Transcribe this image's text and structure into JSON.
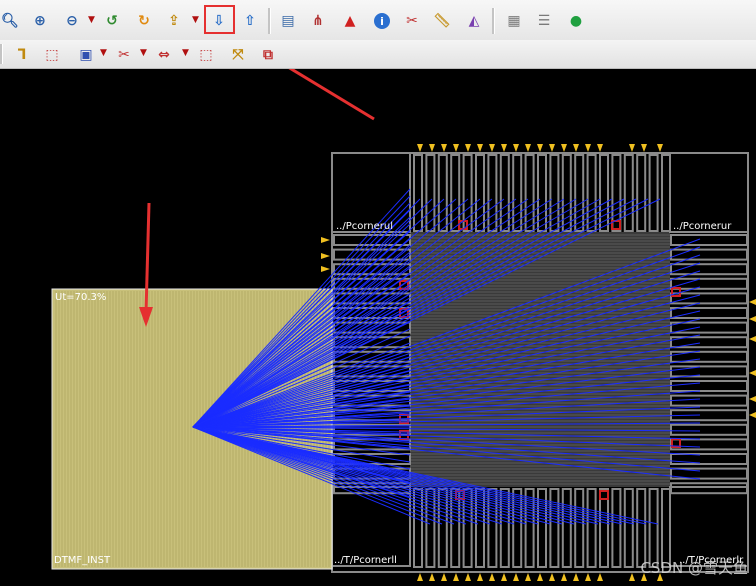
{
  "toolbar_row1": [
    {
      "icon": "zoom-icon",
      "glyph": "🔍︎",
      "color": "#2a5fa8"
    },
    {
      "icon": "zoom-in-icon",
      "glyph": "⊕",
      "color": "#2a5fa8"
    },
    {
      "icon": "zoom-out-icon",
      "glyph": "⊖",
      "color": "#2a5fa8"
    },
    {
      "icon": "pan-icon",
      "glyph": "↺",
      "color": "#2f8a2f"
    },
    {
      "icon": "refresh-icon",
      "glyph": "↻",
      "color": "#e08a10"
    },
    {
      "icon": "load-icon",
      "glyph": "⇪",
      "color": "#c08a10"
    },
    {
      "icon": "push-down-icon",
      "glyph": "⇩",
      "color": "#2a6fc8"
    },
    {
      "icon": "pop-up-icon",
      "glyph": "⇧",
      "color": "#2a6fc8"
    },
    {
      "icon": "panel-icon",
      "glyph": "▤",
      "color": "#3a6aa8"
    },
    {
      "icon": "hierarchy-icon",
      "glyph": "⋔",
      "color": "#b03030"
    },
    {
      "icon": "warning-icon",
      "glyph": "▲",
      "color": "#d02020"
    },
    {
      "icon": "info-icon",
      "glyph": "i",
      "color": "#ffffff"
    },
    {
      "icon": "cut-icon",
      "glyph": "✂",
      "color": "#c03030"
    },
    {
      "icon": "ruler-icon",
      "glyph": "📏︎",
      "color": "#c89a30"
    },
    {
      "icon": "measure-icon",
      "glyph": "◭",
      "color": "#7a40b0"
    },
    {
      "icon": "properties-icon",
      "glyph": "▦",
      "color": "#7a7a7a"
    },
    {
      "icon": "document-icon",
      "glyph": "☰",
      "color": "#7a7a7a"
    },
    {
      "icon": "go-icon",
      "glyph": "●",
      "color": "#20a040"
    }
  ],
  "toolbar_row2": [
    {
      "icon": "route-icon",
      "glyph": "ᒣ",
      "color": "#c08a10"
    },
    {
      "icon": "select-icon",
      "glyph": "⬚",
      "color": "#c03030"
    },
    {
      "icon": "box-select-icon",
      "glyph": "▣",
      "color": "#3050b0"
    },
    {
      "icon": "scissors-icon",
      "glyph": "✂",
      "color": "#c03030"
    },
    {
      "icon": "stretch-icon",
      "glyph": "⇔",
      "color": "#c03030"
    },
    {
      "icon": "copy-select-icon",
      "glyph": "⬚",
      "color": "#c03030"
    },
    {
      "icon": "move-icon",
      "glyph": "⤧",
      "color": "#c08a10"
    },
    {
      "icon": "align-icon",
      "glyph": "⧉",
      "color": "#c03030"
    }
  ],
  "labels": {
    "corner_ul": "../Pcornerul",
    "corner_ur": "../Pcornerur",
    "corner_ll": "../T/Pcornerll",
    "corner_lr": "../T/Pcornerlr",
    "module_util": "Ut=70.3%",
    "module_name": "DTMF_INST",
    "watermark": "CSDN @雪天鱼"
  },
  "colors": {
    "background": "#000000",
    "module_fill": "#c8c07a",
    "flylines": "#1a2cff",
    "pad_outline": "#8a8a8a",
    "io_pin": "#f0c020",
    "annotation": "#e53030"
  }
}
